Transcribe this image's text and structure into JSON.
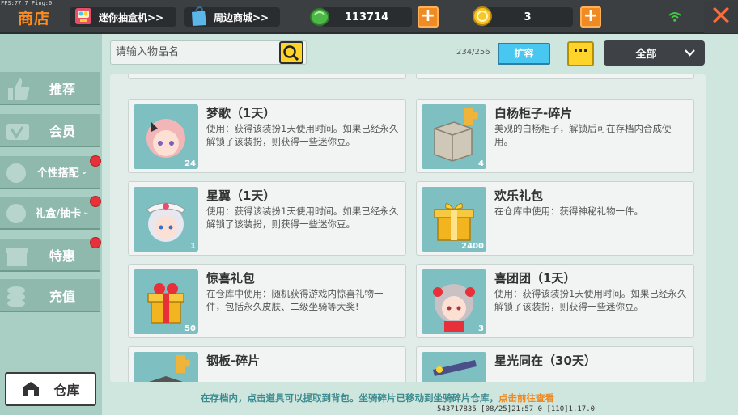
{
  "debug": {
    "fps_text": "FPS:77.7  Ping:0"
  },
  "header": {
    "title": "商店",
    "link_gacha": "迷你抽盒机>>",
    "link_merch": "周边商城>>",
    "currency_gem": "113714",
    "currency_coin": "3",
    "plus_label": "+",
    "close_label": "✕"
  },
  "sidebar": {
    "items": [
      {
        "label": "推荐"
      },
      {
        "label": "会员"
      },
      {
        "label": "个性搭配"
      },
      {
        "label": "礼盒/抽卡"
      },
      {
        "label": "特惠"
      },
      {
        "label": "充值"
      }
    ],
    "warehouse_label": "仓库"
  },
  "toolbar": {
    "search_placeholder": "请输入物品名",
    "capacity": "234/256",
    "expand_label": "扩容",
    "more_label": "···",
    "filter_selected": "全部"
  },
  "items": [
    {
      "name": "梦歌（1天）",
      "desc": "使用：获得该装扮1天使用时间。如果已经永久解锁了该装扮，则获得一些迷你豆。",
      "qty": "24"
    },
    {
      "name": "白杨柜子-碎片",
      "desc": "美观的白杨柜子，解锁后可在存档内合成使用。",
      "qty": "4"
    },
    {
      "name": "星翼（1天）",
      "desc": "使用：获得该装扮1天使用时间。如果已经永久解锁了该装扮，则获得一些迷你豆。",
      "qty": "1"
    },
    {
      "name": "欢乐礼包",
      "desc": "在仓库中使用：获得神秘礼物一件。",
      "qty": "2400"
    },
    {
      "name": "惊喜礼包",
      "desc": "在仓库中使用：随机获得游戏内惊喜礼物一件，包括永久皮肤、二级坐骑等大奖!",
      "qty": "50"
    },
    {
      "name": "喜团团（1天）",
      "desc": "使用：获得该装扮1天使用时间。如果已经永久解锁了该装扮，则获得一些迷你豆。",
      "qty": "3"
    },
    {
      "name": "钢板-碎片",
      "desc": "",
      "qty": ""
    },
    {
      "name": "星光同在（30天）",
      "desc": "",
      "qty": ""
    }
  ],
  "footer": {
    "note": "在存档内，点击道具可以提取到背包。坐骑碎片已移动到坐骑碎片仓库，",
    "link": "点击前往查看",
    "status": "543717835   [08/25]21:57 0  [110]1.17.0"
  },
  "colors": {
    "accent": "#f08a22",
    "brand_orange": "#ff8c1a",
    "expand_blue": "#48c8f0",
    "yellow": "#ffd42a"
  }
}
